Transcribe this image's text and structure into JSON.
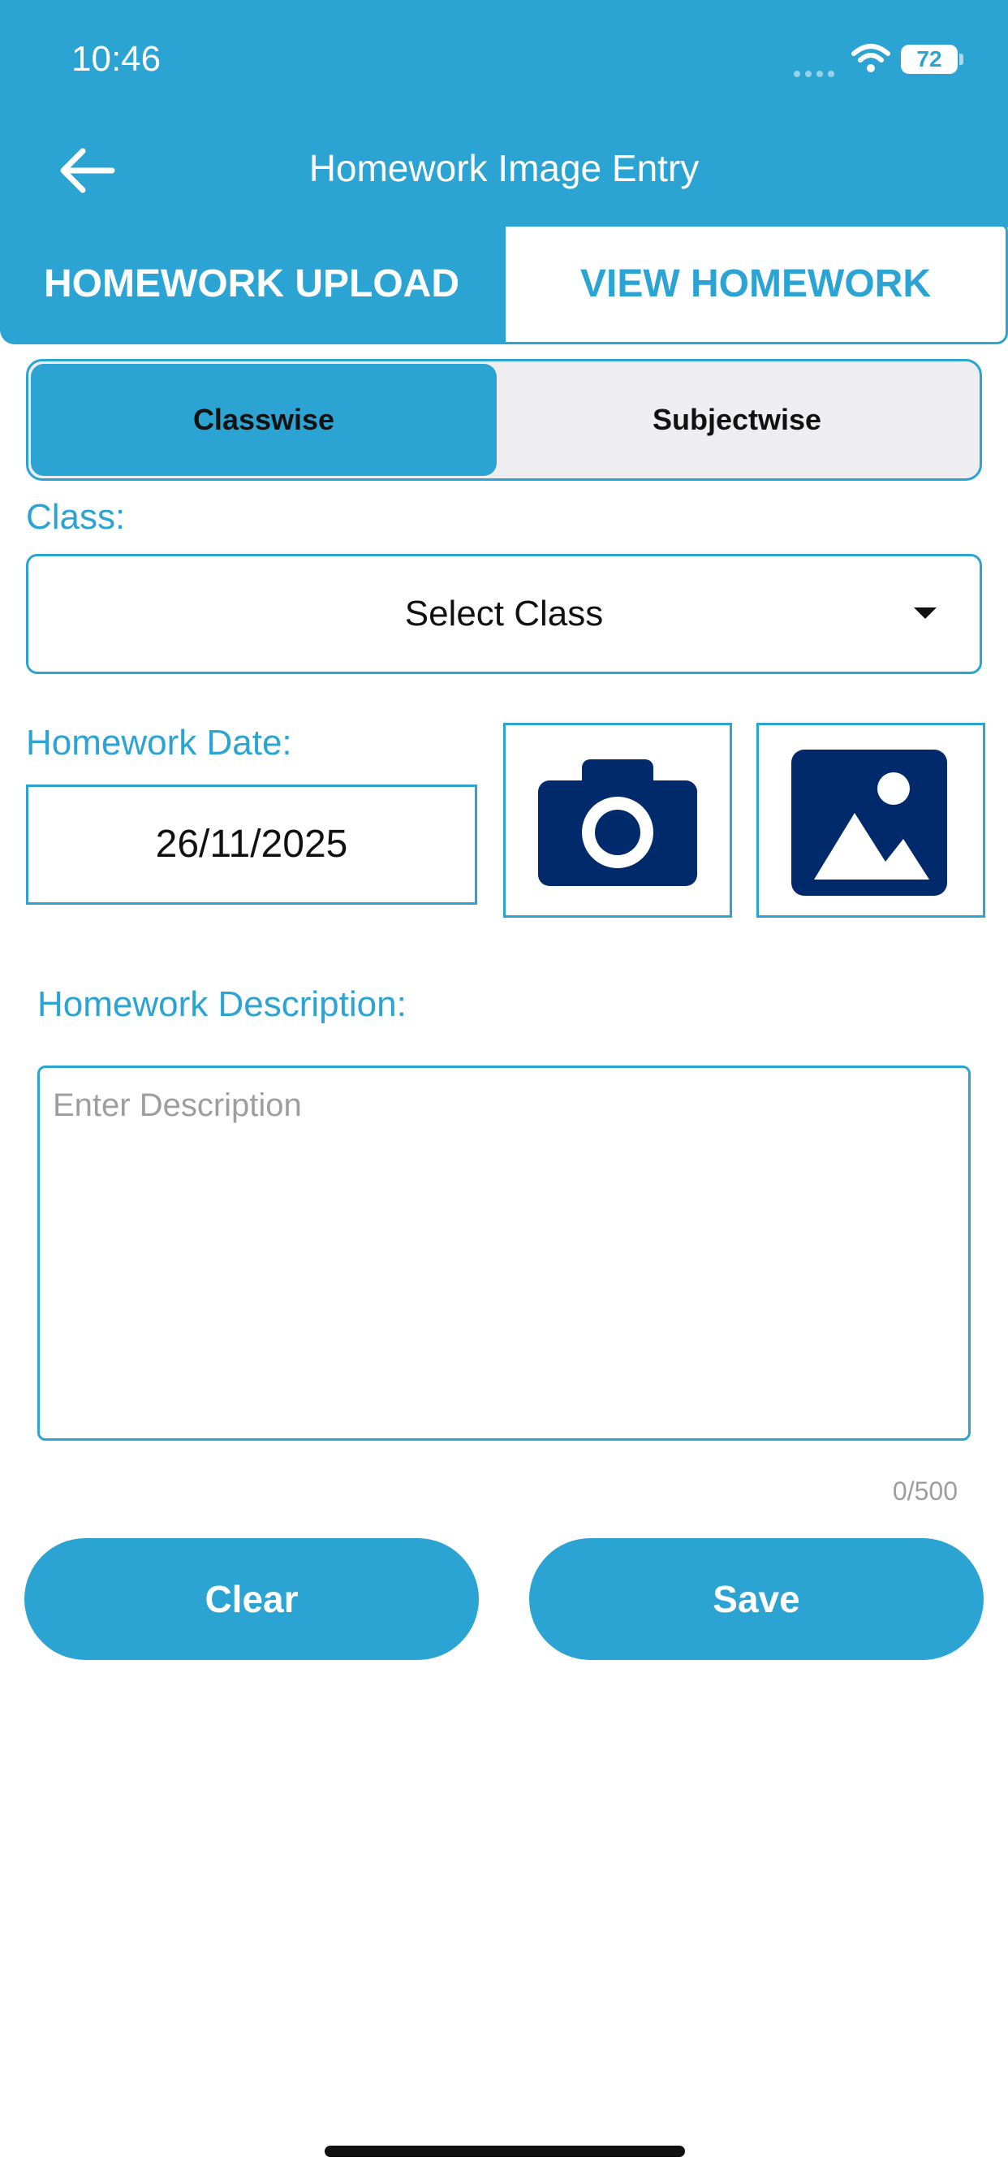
{
  "status_bar": {
    "time": "10:46",
    "battery": "72"
  },
  "header": {
    "title": "Homework Image Entry",
    "back_icon": "arrow-left-icon"
  },
  "tabs": [
    {
      "label": "HOMEWORK UPLOAD",
      "active": true
    },
    {
      "label": "VIEW HOMEWORK",
      "active": false
    }
  ],
  "segment": {
    "classwise": "Classwise",
    "subjectwise": "Subjectwise",
    "selected": "Classwise"
  },
  "form": {
    "class_label": "Class:",
    "class_value": "Select Class",
    "date_label": "Homework Date:",
    "date_value": "26/11/2025",
    "camera_icon": "camera-icon",
    "gallery_icon": "image-gallery-icon",
    "desc_label": "Homework Description:",
    "desc_placeholder": "Enter Description",
    "desc_value": "",
    "counter": "0/500"
  },
  "buttons": {
    "clear": "Clear",
    "save": "Save"
  },
  "colors": {
    "accent": "#2ba3d3",
    "icon_dark": "#002a6b"
  }
}
